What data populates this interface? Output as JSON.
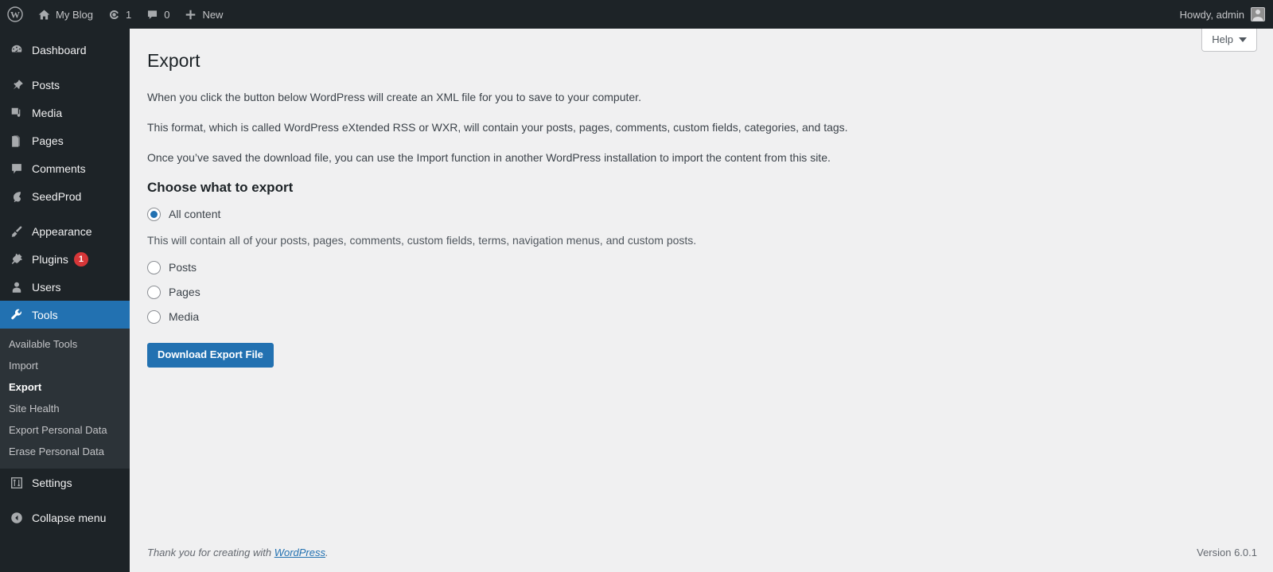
{
  "adminbar": {
    "wp_logo": "wordpress-logo",
    "site_name": "My Blog",
    "updates_count": "1",
    "comments_count": "0",
    "new_label": "New",
    "howdy": "Howdy, admin"
  },
  "sidebar": {
    "items": [
      {
        "label": "Dashboard",
        "icon": "dashboard-icon",
        "active": false
      },
      {
        "label": "Posts",
        "icon": "pin-icon",
        "active": false
      },
      {
        "label": "Media",
        "icon": "media-icon",
        "active": false
      },
      {
        "label": "Pages",
        "icon": "page-icon",
        "active": false
      },
      {
        "label": "Comments",
        "icon": "comment-icon",
        "active": false
      },
      {
        "label": "SeedProd",
        "icon": "seedprod-icon",
        "active": false
      },
      {
        "label": "Appearance",
        "icon": "brush-icon",
        "active": false
      },
      {
        "label": "Plugins",
        "icon": "plugin-icon",
        "active": false,
        "badge": "1"
      },
      {
        "label": "Users",
        "icon": "user-icon",
        "active": false
      },
      {
        "label": "Tools",
        "icon": "wrench-icon",
        "active": true
      }
    ],
    "submenu": [
      {
        "label": "Available Tools",
        "current": false
      },
      {
        "label": "Import",
        "current": false
      },
      {
        "label": "Export",
        "current": true
      },
      {
        "label": "Site Health",
        "current": false
      },
      {
        "label": "Export Personal Data",
        "current": false
      },
      {
        "label": "Erase Personal Data",
        "current": false
      }
    ],
    "settings_label": "Settings",
    "collapse_label": "Collapse menu"
  },
  "help_tab": {
    "label": "Help"
  },
  "main": {
    "title": "Export",
    "para1": "When you click the button below WordPress will create an XML file for you to save to your computer.",
    "para2": "This format, which is called WordPress eXtended RSS or WXR, will contain your posts, pages, comments, custom fields, categories, and tags.",
    "para3": "Once you’ve saved the download file, you can use the Import function in another WordPress installation to import the content from this site.",
    "section_title": "Choose what to export",
    "options": [
      {
        "label": "All content",
        "checked": true,
        "helper": "This will contain all of your posts, pages, comments, custom fields, terms, navigation menus, and custom posts."
      },
      {
        "label": "Posts",
        "checked": false
      },
      {
        "label": "Pages",
        "checked": false
      },
      {
        "label": "Media",
        "checked": false
      }
    ],
    "submit_label": "Download Export File"
  },
  "footer": {
    "thanks_prefix": "Thank you for creating with ",
    "link_label": "WordPress",
    "thanks_suffix": ".",
    "version": "Version 6.0.1"
  },
  "colors": {
    "admin_dark": "#1d2327",
    "submenu_bg": "#2c3338",
    "accent_blue": "#2271b1",
    "badge_red": "#d63638",
    "page_bg": "#f0f0f1"
  }
}
